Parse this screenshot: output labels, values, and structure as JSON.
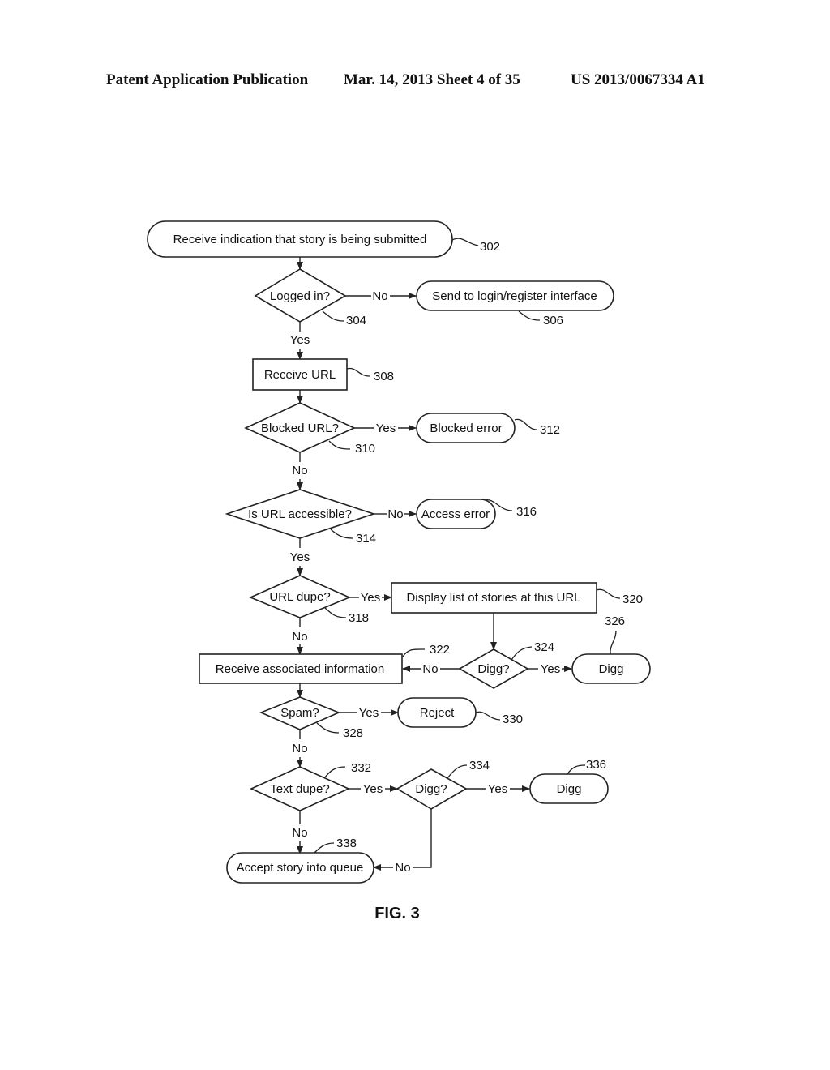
{
  "header": {
    "publication": "Patent Application Publication",
    "date_sheet": "Mar. 14, 2013  Sheet 4 of 35",
    "number": "US 2013/0067334 A1"
  },
  "figure_label": "FIG. 3",
  "nodes": {
    "n302": {
      "text": "Receive indication that story is being submitted",
      "ref": "302",
      "shape": "terminal"
    },
    "n304": {
      "text": "Logged in?",
      "ref": "304",
      "shape": "decision"
    },
    "n306": {
      "text": "Send to login/register interface",
      "ref": "306",
      "shape": "terminal"
    },
    "n308": {
      "text": "Receive URL",
      "ref": "308",
      "shape": "process"
    },
    "n310": {
      "text": "Blocked URL?",
      "ref": "310",
      "shape": "decision"
    },
    "n312": {
      "text": "Blocked error",
      "ref": "312",
      "shape": "terminal"
    },
    "n314": {
      "text": "Is URL accessible?",
      "ref": "314",
      "shape": "decision"
    },
    "n316": {
      "text": "Access error",
      "ref": "316",
      "shape": "terminal"
    },
    "n318": {
      "text": "URL dupe?",
      "ref": "318",
      "shape": "decision"
    },
    "n320": {
      "text": "Display list of stories at this URL",
      "ref": "320",
      "shape": "process"
    },
    "n322": {
      "text": "Receive associated information",
      "ref": "322",
      "shape": "process"
    },
    "n324": {
      "text": "Digg?",
      "ref": "324",
      "shape": "decision"
    },
    "n326": {
      "text": "Digg",
      "ref": "326",
      "shape": "terminal"
    },
    "n328": {
      "text": "Spam?",
      "ref": "328",
      "shape": "decision"
    },
    "n330": {
      "text": "Reject",
      "ref": "330",
      "shape": "terminal"
    },
    "n332": {
      "text": "Text dupe?",
      "ref": "332",
      "shape": "decision"
    },
    "n334": {
      "text": "Digg?",
      "ref": "334",
      "shape": "decision"
    },
    "n336": {
      "text": "Digg",
      "ref": "336",
      "shape": "terminal"
    },
    "n338": {
      "text": "Accept story into queue",
      "ref": "338",
      "shape": "terminal"
    }
  },
  "edges": {
    "e302_304": {
      "from": "302",
      "to": "304",
      "label": ""
    },
    "e304_306": {
      "from": "304",
      "to": "306",
      "label": "No"
    },
    "e304_308": {
      "from": "304",
      "to": "308",
      "label": "Yes"
    },
    "e308_310": {
      "from": "308",
      "to": "310",
      "label": ""
    },
    "e310_312": {
      "from": "310",
      "to": "312",
      "label": "Yes"
    },
    "e310_314": {
      "from": "310",
      "to": "314",
      "label": "No"
    },
    "e314_316": {
      "from": "314",
      "to": "316",
      "label": "No"
    },
    "e314_318": {
      "from": "314",
      "to": "318",
      "label": "Yes"
    },
    "e318_320": {
      "from": "318",
      "to": "320",
      "label": "Yes"
    },
    "e318_322": {
      "from": "318",
      "to": "322",
      "label": "No"
    },
    "e320_324": {
      "from": "320",
      "to": "324",
      "label": ""
    },
    "e324_322": {
      "from": "324",
      "to": "322",
      "label": "No"
    },
    "e324_326": {
      "from": "324",
      "to": "326",
      "label": "Yes"
    },
    "e322_328": {
      "from": "322",
      "to": "328",
      "label": ""
    },
    "e328_330": {
      "from": "328",
      "to": "330",
      "label": "Yes"
    },
    "e328_332": {
      "from": "328",
      "to": "332",
      "label": "No"
    },
    "e332_334": {
      "from": "332",
      "to": "334",
      "label": "Yes"
    },
    "e332_338": {
      "from": "332",
      "to": "338",
      "label": "No"
    },
    "e334_336": {
      "from": "334",
      "to": "336",
      "label": "Yes"
    },
    "e334_338": {
      "from": "334",
      "to": "338",
      "label": "No"
    }
  }
}
